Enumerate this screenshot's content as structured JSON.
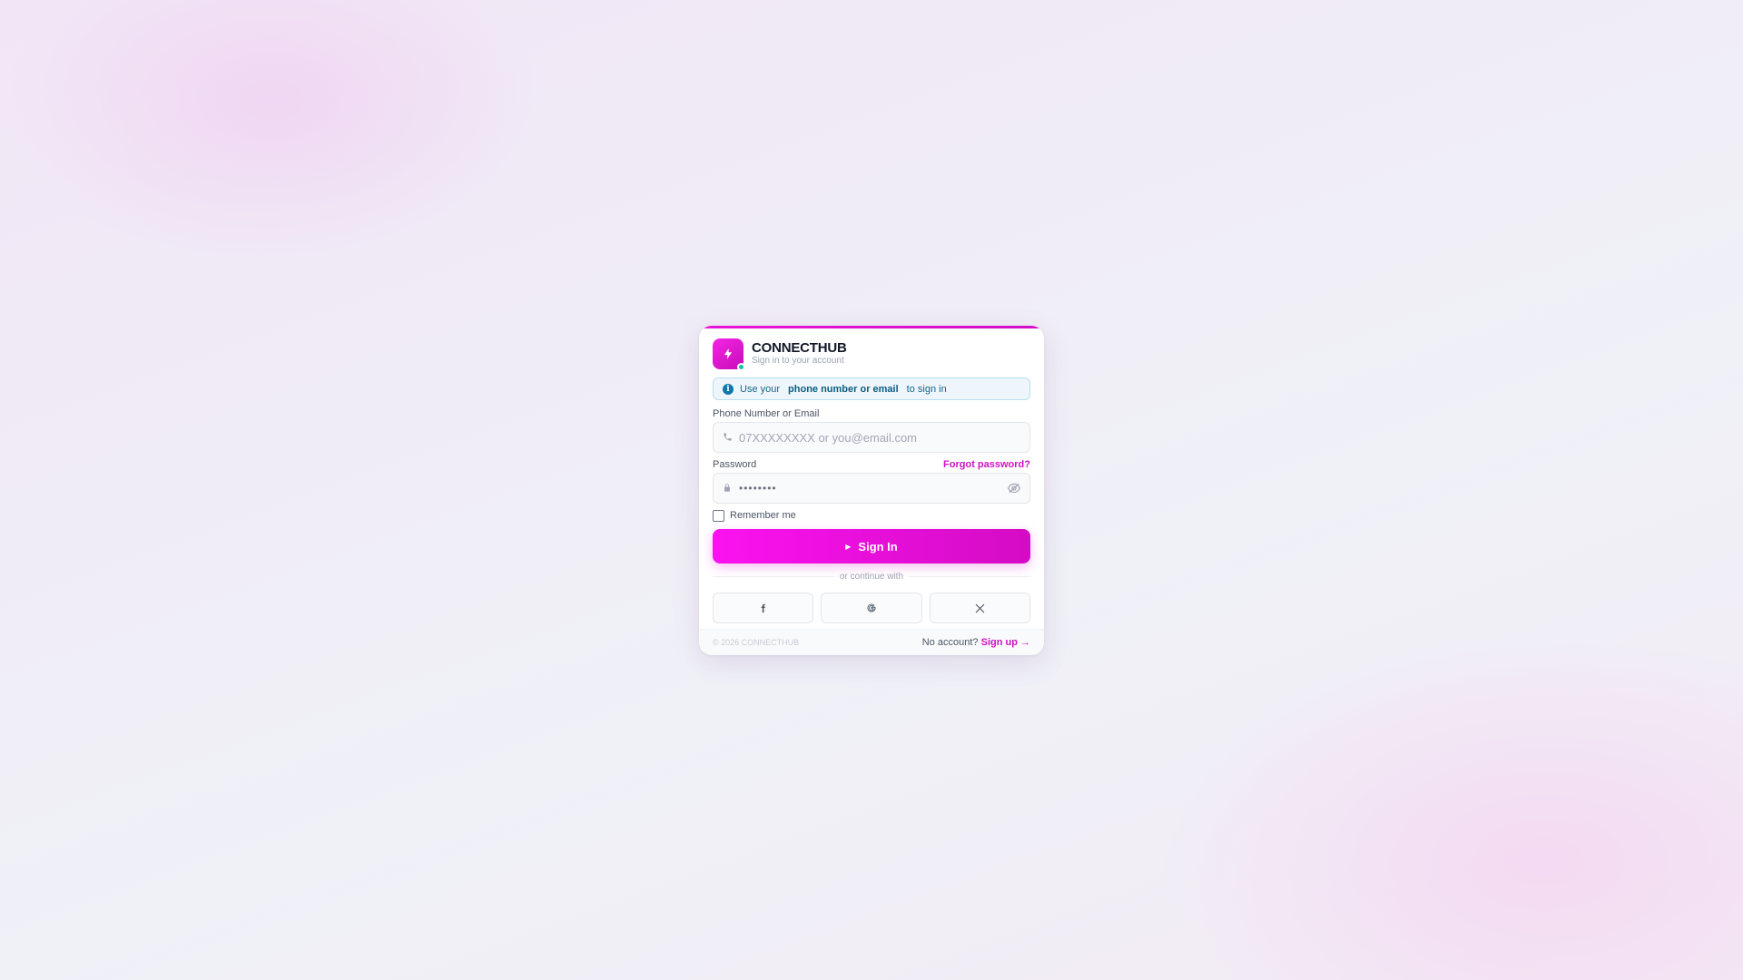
{
  "brand": {
    "name": "CONNECTHUB",
    "subtitle": "Sign in to your account",
    "icon": "bolt-icon",
    "accent": "#e815d9"
  },
  "info": {
    "prefix": "Use your",
    "highlight": "phone number or email",
    "suffix": "to sign in",
    "icon": "info-icon"
  },
  "form": {
    "identifier_label": "Phone Number or Email",
    "identifier_placeholder": "07XXXXXXXX or you@email.com",
    "identifier_icon": "phone-icon",
    "password_label": "Password",
    "forgot_label": "Forgot password?",
    "password_mask": "••••••••",
    "password_icon": "lock-icon",
    "toggle_icon": "eye-off-icon",
    "remember_label": "Remember me",
    "remember_checked": false,
    "submit_label": "Sign In",
    "submit_icon": "play-icon"
  },
  "divider": "or continue with",
  "social": [
    {
      "name": "facebook",
      "icon": "facebook-icon"
    },
    {
      "name": "google",
      "icon": "google-icon"
    },
    {
      "name": "x",
      "icon": "x-icon"
    }
  ],
  "footer": {
    "copyright": "© 2026 CONNECTHUB",
    "no_account": "No account?",
    "signup_label": "Sign up →"
  }
}
